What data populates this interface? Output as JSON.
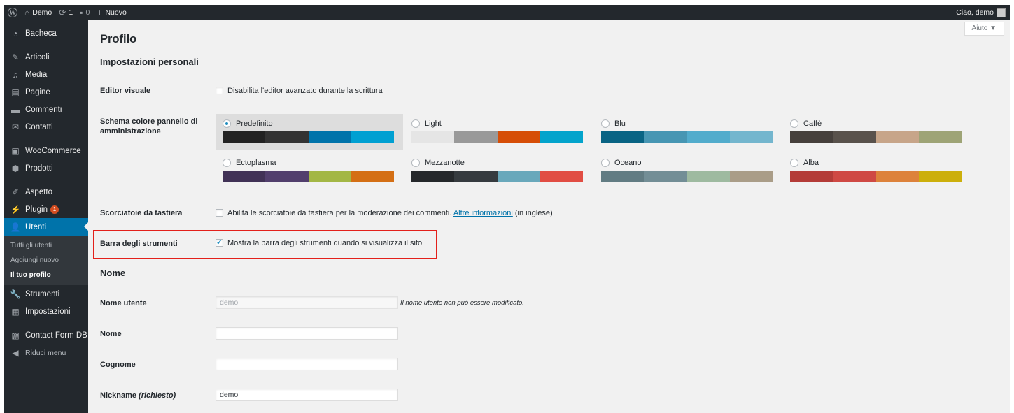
{
  "adminbar": {
    "site_name": "Demo",
    "updates_count": "1",
    "comments_count": "0",
    "new_label": "Nuovo",
    "greeting": "Ciao, demo"
  },
  "sidebar": {
    "items": [
      {
        "label": "Bacheca",
        "icon": "dashboard-icon"
      },
      {
        "label": "Articoli",
        "icon": "pin-icon"
      },
      {
        "label": "Media",
        "icon": "media-icon"
      },
      {
        "label": "Pagine",
        "icon": "page-icon"
      },
      {
        "label": "Commenti",
        "icon": "comment-icon"
      },
      {
        "label": "Contatti",
        "icon": "mail-icon"
      },
      {
        "label": "WooCommerce",
        "icon": "woo-icon"
      },
      {
        "label": "Prodotti",
        "icon": "box-icon"
      },
      {
        "label": "Aspetto",
        "icon": "brush-icon"
      },
      {
        "label": "Plugin",
        "icon": "plug-icon",
        "badge": "1"
      },
      {
        "label": "Utenti",
        "icon": "user-icon"
      },
      {
        "label": "Strumenti",
        "icon": "wrench-icon"
      },
      {
        "label": "Impostazioni",
        "icon": "settings-icon"
      },
      {
        "label": "Contact Form DB",
        "icon": "db-icon"
      }
    ],
    "submenu": [
      "Tutti gli utenti",
      "Aggiungi nuovo",
      "Il tuo profilo"
    ],
    "collapse_label": "Riduci menu"
  },
  "help_label": "Aiuto ▼",
  "page_title": "Profilo",
  "personal": {
    "title": "Impostazioni personali",
    "editor_label": "Editor visuale",
    "editor_option": "Disabilita l'editor avanzato durante la scrittura",
    "scheme_label_1": "Schema colore pannello di",
    "scheme_label_2": "amministrazione",
    "schemes": [
      {
        "name": "Predefinito",
        "colors": [
          "#222222",
          "#333333",
          "#0073aa",
          "#00a0d2"
        ],
        "selected": true
      },
      {
        "name": "Light",
        "colors": [
          "#e5e5e5",
          "#999999",
          "#d64e07",
          "#04a4cc"
        ]
      },
      {
        "name": "Blu",
        "colors": [
          "#096484",
          "#4796b3",
          "#52accc",
          "#74b6ce"
        ]
      },
      {
        "name": "Caffè",
        "colors": [
          "#46403c",
          "#59524c",
          "#c7a589",
          "#9ea476"
        ]
      },
      {
        "name": "Ectoplasma",
        "colors": [
          "#413256",
          "#523f6d",
          "#a3b745",
          "#d46f15"
        ]
      },
      {
        "name": "Mezzanotte",
        "colors": [
          "#25282b",
          "#363b3f",
          "#69a8bb",
          "#e14d43"
        ]
      },
      {
        "name": "Oceano",
        "colors": [
          "#627c83",
          "#738e96",
          "#9ebaa0",
          "#aa9d88"
        ]
      },
      {
        "name": "Alba",
        "colors": [
          "#b43c38",
          "#cf4944",
          "#dd823b",
          "#ccaf0b"
        ]
      }
    ],
    "shortcuts_label": "Scorciatoie da tastiera",
    "shortcuts_text": "Abilita le scorciatoie da tastiera per la moderazione dei commenti.",
    "shortcuts_link": "Altre informazioni",
    "shortcuts_suffix": "(in inglese)",
    "toolbar_label": "Barra degli strumenti",
    "toolbar_option": "Mostra la barra degli strumenti quando si visualizza il sito"
  },
  "name_section": {
    "title": "Nome",
    "username_label": "Nome utente",
    "username_value": "demo",
    "username_desc": "Il nome utente non può essere modificato.",
    "first_label": "Nome",
    "first_value": "",
    "last_label": "Cognome",
    "last_value": "",
    "nickname_label": "Nickname",
    "nickname_required": "(richiesto)",
    "nickname_value": "demo"
  }
}
